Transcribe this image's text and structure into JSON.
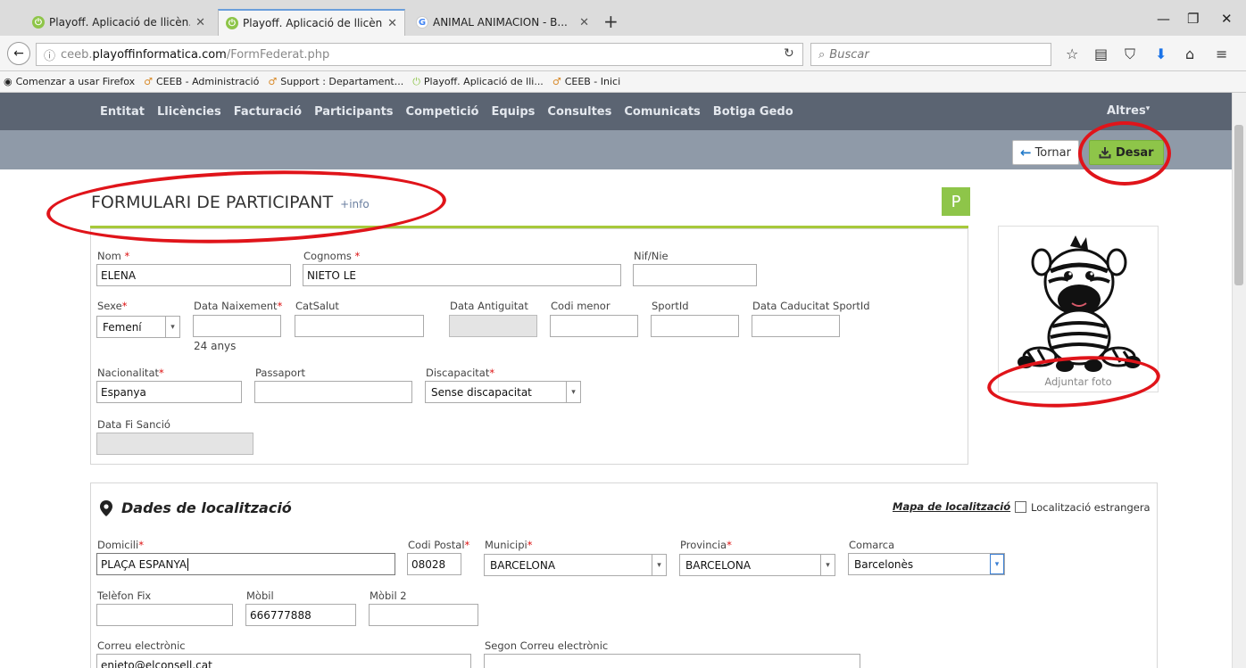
{
  "browser": {
    "tabs": [
      {
        "label": "Playoff. Aplicació de llicèn...",
        "icon": "playoff-favicon"
      },
      {
        "label": "Playoff. Aplicació de llicèn...",
        "icon": "playoff-favicon"
      },
      {
        "label": "ANIMAL ANIMACION - B...",
        "icon": "google-favicon"
      }
    ],
    "url_host_prefix": "ceeb.",
    "url_host": "playoffinformatica.com",
    "url_path": "/FormFederat.php",
    "search_placeholder": "Buscar",
    "bookmarks": [
      "Comenzar a usar Firefox",
      "CEEB - Administració",
      "Support : Departament...",
      "Playoff. Aplicació de lli...",
      "CEEB - Inici"
    ]
  },
  "nav": {
    "items": [
      "Entitat",
      "Llicències",
      "Facturació",
      "Participants",
      "Competició",
      "Equips",
      "Consultes",
      "Comunicats",
      "Botiga Gedo"
    ],
    "altres": "Altres"
  },
  "toolbar": {
    "back_label": "Tornar",
    "save_label": "Desar"
  },
  "form": {
    "title": "FORMULARI DE PARTICIPANT",
    "info_link": "+info",
    "badge": "P",
    "photo_caption": "Adjuntar foto",
    "fields": {
      "nom": {
        "label": "Nom",
        "value": "ELENA"
      },
      "cognoms": {
        "label": "Cognoms",
        "value": "NIETO LE"
      },
      "nif": {
        "label": "Nif/Nie",
        "value": ""
      },
      "sexe": {
        "label": "Sexe",
        "value": "Femení"
      },
      "data_naixement": {
        "label": "Data Naixement",
        "value": "",
        "age": "24 anys"
      },
      "catsalut": {
        "label": "CatSalut",
        "value": ""
      },
      "data_antiguitat": {
        "label": "Data Antiguitat",
        "value": ""
      },
      "codi_menor": {
        "label": "Codi menor",
        "value": ""
      },
      "sportid": {
        "label": "SportId",
        "value": ""
      },
      "data_caducitat": {
        "label": "Data Caducitat SportId",
        "value": ""
      },
      "nacionalitat": {
        "label": "Nacionalitat",
        "value": "Espanya"
      },
      "passaport": {
        "label": "Passaport",
        "value": ""
      },
      "discapacitat": {
        "label": "Discapacitat",
        "value": "Sense discapacitat"
      },
      "data_fi_sancio": {
        "label": "Data Fi Sanció",
        "value": ""
      }
    }
  },
  "location": {
    "title": "Dades de localització",
    "map_link": "Mapa de localització",
    "foreign_label": "Localització estrangera",
    "fields": {
      "domicili": {
        "label": "Domicili",
        "value": "PLAÇA ESPANYA"
      },
      "codi_postal": {
        "label": "Codi Postal",
        "value": "08028"
      },
      "municipi": {
        "label": "Municipi",
        "value": "BARCELONA"
      },
      "provincia": {
        "label": "Provincia",
        "value": "BARCELONA"
      },
      "comarca": {
        "label": "Comarca",
        "value": "Barcelonès"
      },
      "telefon": {
        "label": "Telèfon Fix",
        "value": ""
      },
      "mobil": {
        "label": "Mòbil",
        "value": "666777888"
      },
      "mobil2": {
        "label": "Mòbil 2",
        "value": ""
      },
      "correu": {
        "label": "Correu electrònic",
        "value": "enieto@elconsell.cat"
      },
      "correu2": {
        "label": "Segon Correu electrònic",
        "value": ""
      }
    }
  },
  "colors": {
    "nav_bg": "#5b6472",
    "toolbar_bg": "#8f9aa8",
    "accent_green": "#8ec549",
    "annotation_red": "#e0141a"
  }
}
